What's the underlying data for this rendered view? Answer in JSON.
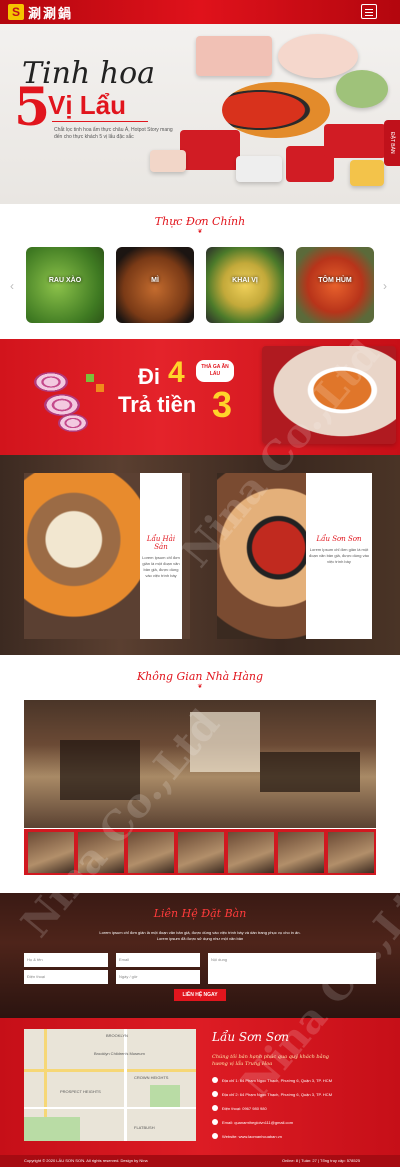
{
  "header": {
    "logo_badge": "S",
    "logo_text": "涮涮鍋",
    "menu_label": "menu"
  },
  "hero": {
    "title1": "Tinh hoa",
    "number": "5",
    "title2": "Vị Lẩu",
    "desc": "Chắt lọc tinh hoa ẩm thực châu Á, Hotpot Story mang đến cho thực khách 5 vị lẩu đặc sắc",
    "side_tab": "ĐẶT BÀN"
  },
  "menu": {
    "title": "Thực Đơn Chính",
    "items": [
      "RAU XÀO",
      "MÌ",
      "KHAI VỊ",
      "TÔM HÙM"
    ],
    "prev": "‹",
    "next": "›"
  },
  "promo": {
    "di": "Đi",
    "four": "4",
    "tra": "Trả tiền",
    "three": "3",
    "badge": "THẢ GA ĂN LẨU"
  },
  "panels": [
    {
      "title": "Lẩu Hải Sản",
      "desc": "Lorem Ipsum chỉ đơn giản là một đoạn văn bản giả, được dùng vào việc trình bày"
    },
    {
      "title": "Lẩu Sơn Sơn",
      "desc": "Lorem Ipsum chỉ đơn giản là một đoạn văn bản giả, được dùng vào việc trình bày"
    }
  ],
  "space": {
    "title": "Không Gian Nhà Hàng"
  },
  "contact": {
    "title": "Liên Hệ Đặt Bàn",
    "desc": "Lorem ipsum chỉ đơn giản là một đoạn văn bản giả, được dùng vào việc trình bày và dàn trang phục vụ cho in ấn. Lorem ipsum đã được sử dụng như một văn bản",
    "name_ph": "Họ & tên",
    "email_ph": "Email",
    "note_ph": "Nội dung",
    "phone_ph": "Điện thoại",
    "date_ph": "Ngày / giờ",
    "submit": "LIÊN HỆ NGAY"
  },
  "footer": {
    "brand": "Lẩu Sơn Sơn",
    "slogan": "Chúng tôi bán hạnh phúc qua quý khách bằng hương vị lẩu Trung Hoa",
    "items": [
      "Địa chỉ 1: 64 Phạm Ngọc Thạch, Phường 6, Quận 3, TP. HCM",
      "Địa chỉ 2: 64 Phạm Ngọc Thạch, Phường 6, Quận 3, TP. HCM",
      "Điện thoại: 0967 980 980",
      "Email: quanamthegioivn111@gmail.com",
      "Website: www.laomanhcuaban.vn"
    ],
    "map_labels": [
      "BROOKLYN",
      "Brooklyn Children's Museum",
      "CROWN HEIGHTS",
      "PROSPECT HEIGHTS",
      "FLATBUSH"
    ]
  },
  "bottom": {
    "copyright": "Copyright © 2020 LẨU SƠN SƠN. All rights reserved. Design by Nina",
    "stats": "Online: 8 | Tuần: 27 | Tổng truy cập: 578525"
  },
  "watermark": "Nina Co.,Ltd",
  "colors": {
    "brand_red": "#e1151d",
    "accent_yellow": "#ffd42a"
  }
}
